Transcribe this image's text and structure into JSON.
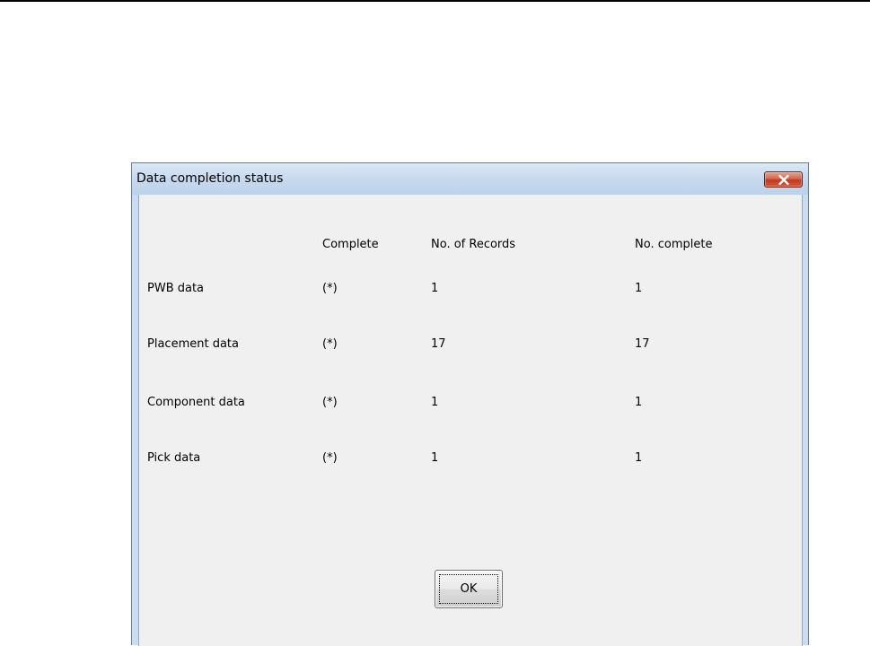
{
  "dialog": {
    "title": "Data completion status",
    "close_icon": "close-x-icon",
    "ok_label": "OK"
  },
  "table": {
    "headers": {
      "complete": "Complete",
      "records": "No. of Records",
      "no_complete": "No. complete"
    },
    "rows": [
      {
        "label": "PWB data",
        "complete": "(*)",
        "records": "1",
        "no_complete": "1"
      },
      {
        "label": "Placement data",
        "complete": "(*)",
        "records": "17",
        "no_complete": "17"
      },
      {
        "label": "Component data",
        "complete": "(*)",
        "records": "1",
        "no_complete": "1"
      },
      {
        "label": "Pick data",
        "complete": "(*)",
        "records": "1",
        "no_complete": "1"
      }
    ]
  },
  "colors": {
    "titlebar": "#c6d9ee",
    "client": "#f0f0f0",
    "close_button": "#c2381c"
  }
}
